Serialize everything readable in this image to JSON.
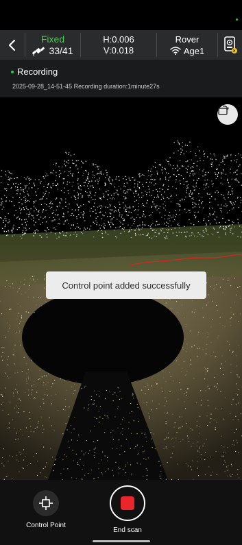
{
  "header": {
    "fix_status": "Fixed",
    "satellites": "33/41",
    "h_precision": "H:0.006",
    "v_precision": "V:0.018",
    "mode": "Rover",
    "age": "Age1"
  },
  "recording": {
    "title": "Recording",
    "info": "2025-09-28_14-51-45 Recording duration:1minute27s"
  },
  "toast": {
    "message": "Control point added successfully"
  },
  "bottom": {
    "control_point_label": "Control Point",
    "end_scan_label": "End scan"
  },
  "colors": {
    "fix_green": "#3fcf4a",
    "record_red": "#e8262b",
    "topbar_bg": "#2a2b2d",
    "toast_bg": "#ececec",
    "trajectory": "#d8261c"
  },
  "icons": {
    "back": "chevron-left-icon",
    "satellite": "satellite-icon",
    "signal": "wifi-signal-icon",
    "device": "device-settings-icon",
    "orientation": "rotate-screen-icon",
    "control_point": "crosshair-icon",
    "end_scan": "stop-icon"
  }
}
